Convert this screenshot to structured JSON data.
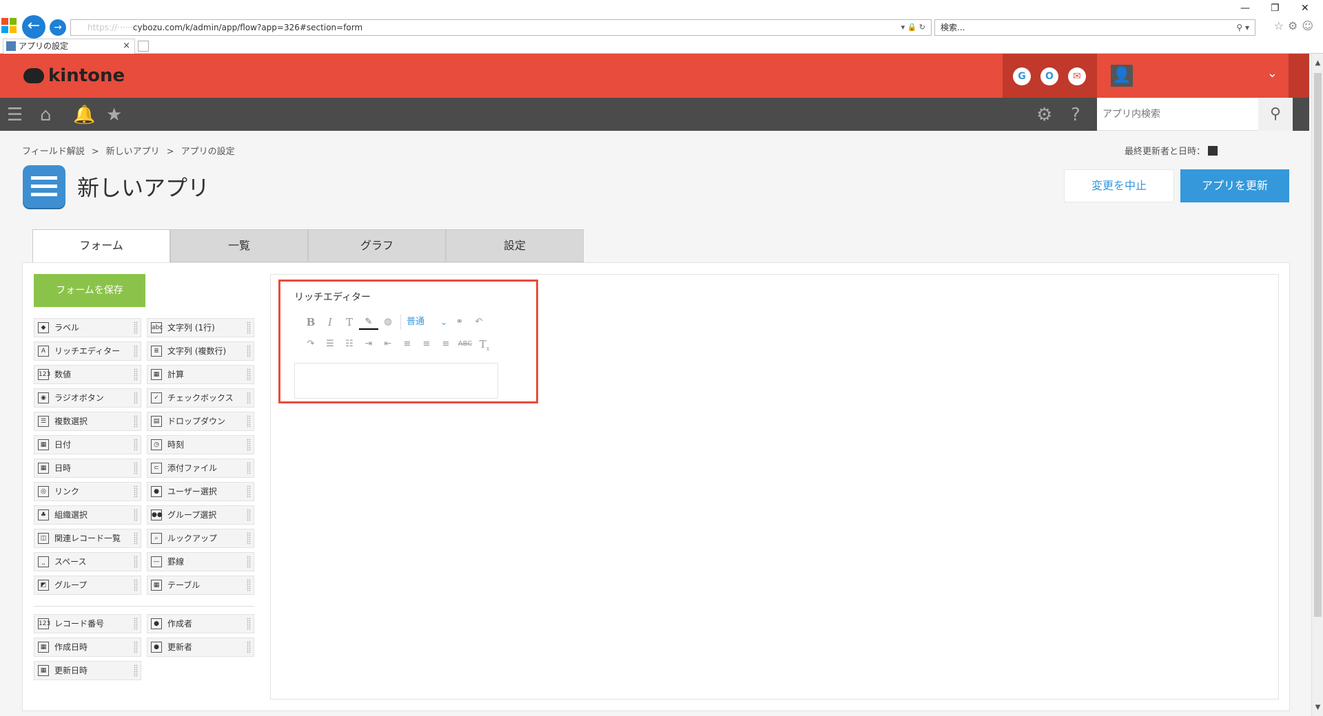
{
  "browser": {
    "url_prefix": "https://",
    "url_domain": "cybozu.com",
    "url_path": "/k/admin/app/flow?app=326#section=form",
    "search_placeholder": "検索...",
    "tab_title": "アプリの設定",
    "tab_close": "×",
    "search_icon": "⚲"
  },
  "header": {
    "logo_text": "kintone",
    "g_label": "G",
    "o_label": "O",
    "mail_label": "✉",
    "chevron": "⌄"
  },
  "nav": {
    "search_placeholder": "アプリ内検索"
  },
  "breadcrumb": {
    "items": [
      "フィールド解説",
      "新しいアプリ",
      "アプリの設定"
    ],
    "separator": ">"
  },
  "last_updated_label": "最終更新者と日時：",
  "app": {
    "title": "新しいアプリ"
  },
  "buttons": {
    "cancel": "変更を中止",
    "update": "アプリを更新",
    "save_form": "フォームを保存"
  },
  "tabs": [
    "フォーム",
    "一覧",
    "グラフ",
    "設定"
  ],
  "palette": {
    "left": [
      {
        "label": "ラベル",
        "icon": "tag-icon"
      },
      {
        "label": "リッチエディター",
        "icon": "rich-editor-icon"
      },
      {
        "label": "数値",
        "icon": "number-icon"
      },
      {
        "label": "ラジオボタン",
        "icon": "radio-icon"
      },
      {
        "label": "複数選択",
        "icon": "multi-select-icon"
      },
      {
        "label": "日付",
        "icon": "calendar-icon"
      },
      {
        "label": "日時",
        "icon": "datetime-icon"
      },
      {
        "label": "リンク",
        "icon": "globe-icon"
      },
      {
        "label": "組織選択",
        "icon": "org-icon"
      },
      {
        "label": "関連レコード一覧",
        "icon": "related-records-icon"
      },
      {
        "label": "スペース",
        "icon": "space-icon"
      },
      {
        "label": "グループ",
        "icon": "group-icon"
      }
    ],
    "right": [
      {
        "label": "文字列 (1行)",
        "icon": "text-single-icon"
      },
      {
        "label": "文字列 (複数行)",
        "icon": "text-multi-icon"
      },
      {
        "label": "計算",
        "icon": "calc-icon"
      },
      {
        "label": "チェックボックス",
        "icon": "checkbox-icon"
      },
      {
        "label": "ドロップダウン",
        "icon": "dropdown-icon"
      },
      {
        "label": "時刻",
        "icon": "clock-icon"
      },
      {
        "label": "添付ファイル",
        "icon": "paperclip-icon"
      },
      {
        "label": "ユーザー選択",
        "icon": "user-icon"
      },
      {
        "label": "グループ選択",
        "icon": "users-icon"
      },
      {
        "label": "ルックアップ",
        "icon": "lookup-icon"
      },
      {
        "label": "罫線",
        "icon": "line-icon"
      },
      {
        "label": "テーブル",
        "icon": "table-icon"
      }
    ],
    "system_left": [
      {
        "label": "レコード番号",
        "icon": "number-icon"
      },
      {
        "label": "作成日時",
        "icon": "calendar-icon"
      },
      {
        "label": "更新日時",
        "icon": "calendar-icon"
      }
    ],
    "system_right": [
      {
        "label": "作成者",
        "icon": "user-icon"
      },
      {
        "label": "更新者",
        "icon": "user-icon"
      }
    ]
  },
  "field": {
    "label": "リッチエディター",
    "format_value": "普通"
  }
}
